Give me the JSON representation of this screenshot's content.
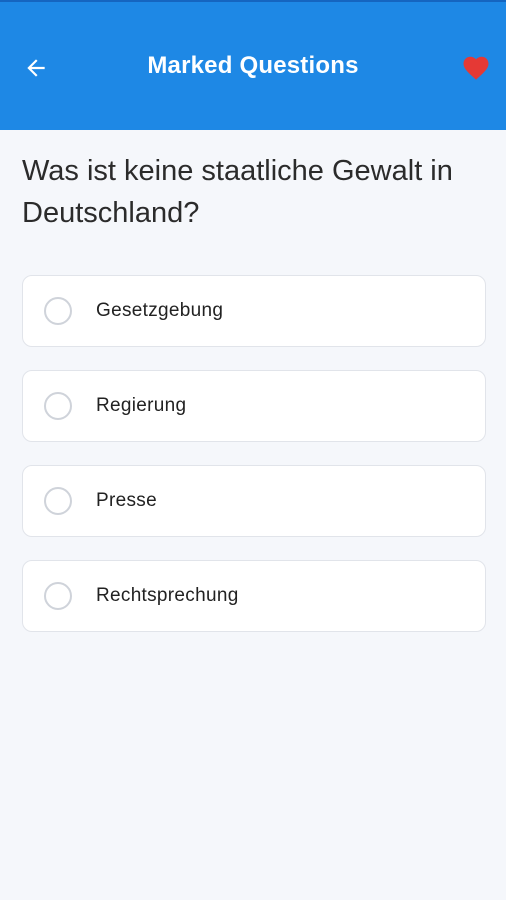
{
  "appbar": {
    "title": "Marked Questions",
    "back_icon": "arrow-left-icon",
    "favorite_icon": "heart-icon",
    "background_color": "#1e88e5",
    "favorite_color": "#e53935"
  },
  "question": {
    "text": "Was ist keine staatliche Gewalt in Deutschland?"
  },
  "options": [
    {
      "label": "Gesetzgebung",
      "selected": false
    },
    {
      "label": "Regierung",
      "selected": false
    },
    {
      "label": "Presse",
      "selected": false
    },
    {
      "label": "Rechtsprechung",
      "selected": false
    }
  ]
}
